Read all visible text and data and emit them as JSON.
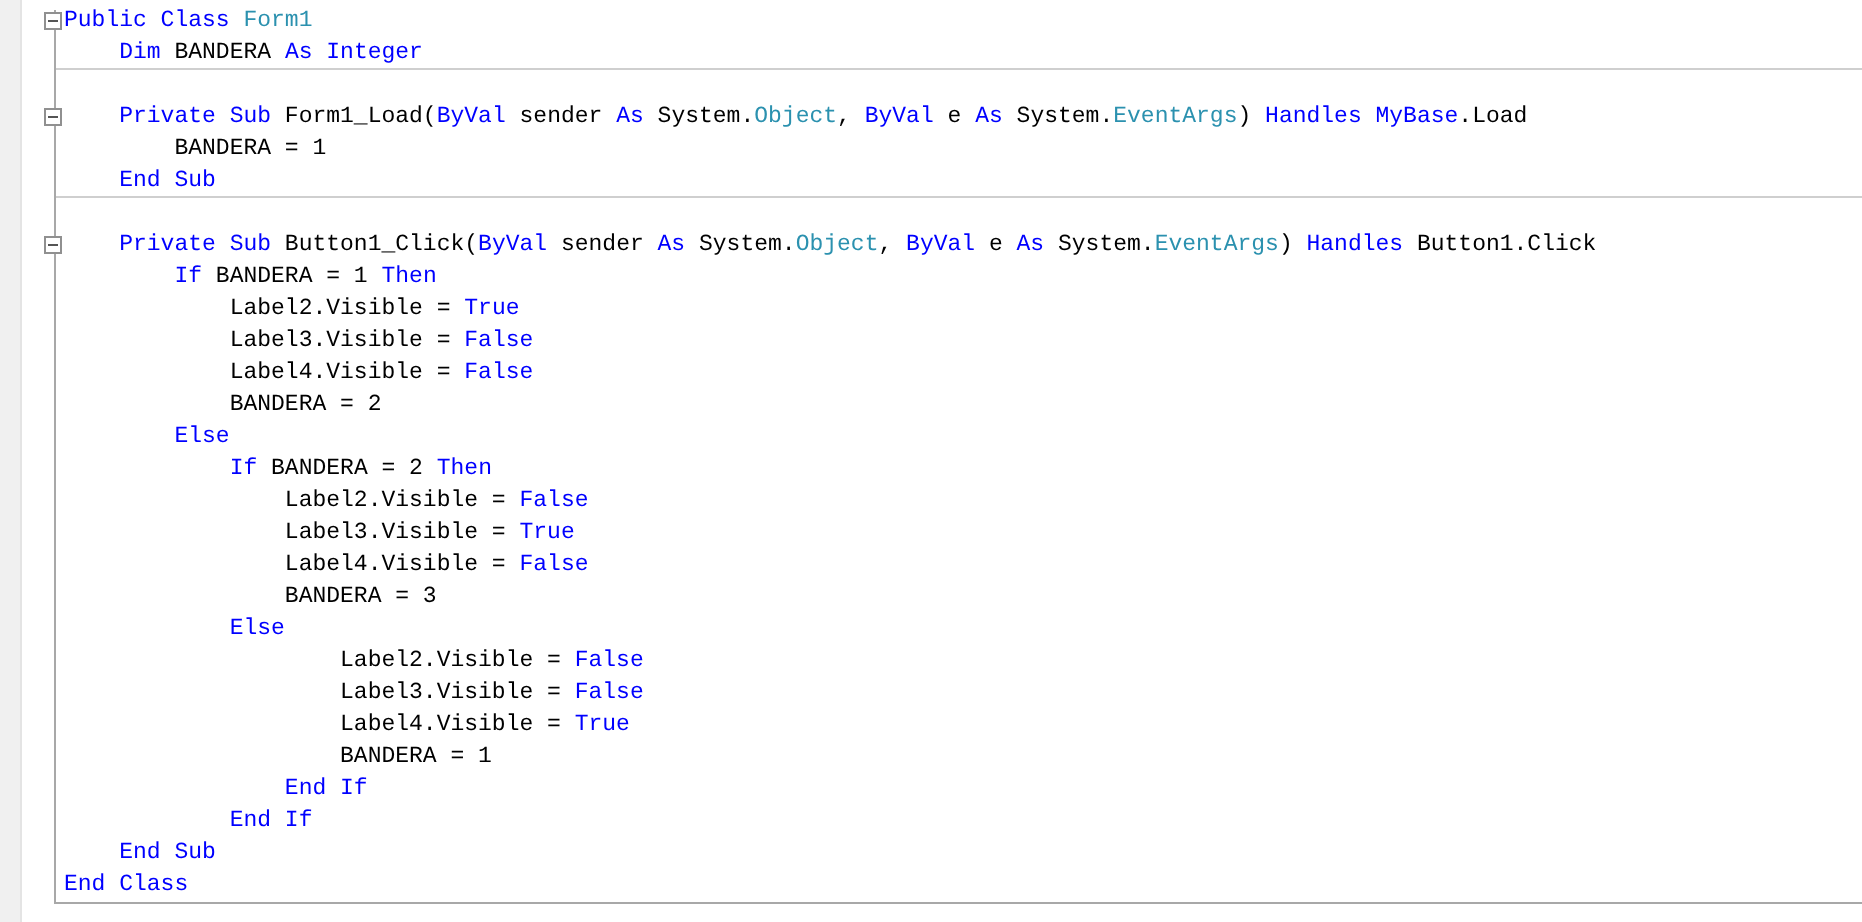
{
  "editor": {
    "lines": [
      {
        "toggle": {
          "expanded": true
        },
        "separator": false,
        "tokens": [
          {
            "kind": "keyword",
            "text": "Public Class "
          },
          {
            "kind": "type",
            "text": "Form1"
          }
        ]
      },
      {
        "separator": true,
        "tokens": [
          {
            "kind": "keyword",
            "text": "    Dim "
          },
          {
            "kind": "plain",
            "text": "BANDERA "
          },
          {
            "kind": "keyword",
            "text": "As Integer"
          }
        ]
      },
      {
        "separator": false
      },
      {
        "toggle": {
          "expanded": true
        },
        "separator": false,
        "tokens": [
          {
            "kind": "keyword",
            "text": "    Private Sub "
          },
          {
            "kind": "plain",
            "text": "Form1_Load("
          },
          {
            "kind": "keyword",
            "text": "ByVal "
          },
          {
            "kind": "plain",
            "text": "sender "
          },
          {
            "kind": "keyword",
            "text": "As "
          },
          {
            "kind": "plain",
            "text": "System."
          },
          {
            "kind": "type",
            "text": "Object"
          },
          {
            "kind": "plain",
            "text": ", "
          },
          {
            "kind": "keyword",
            "text": "ByVal "
          },
          {
            "kind": "plain",
            "text": "e "
          },
          {
            "kind": "keyword",
            "text": "As "
          },
          {
            "kind": "plain",
            "text": "System."
          },
          {
            "kind": "type",
            "text": "EventArgs"
          },
          {
            "kind": "plain",
            "text": ") "
          },
          {
            "kind": "keyword",
            "text": "Handles MyBase"
          },
          {
            "kind": "plain",
            "text": ".Load"
          }
        ]
      },
      {
        "separator": false,
        "tokens": [
          {
            "kind": "plain",
            "text": "        BANDERA = 1"
          }
        ]
      },
      {
        "separator": true,
        "tokens": [
          {
            "kind": "keyword",
            "text": "    End Sub"
          }
        ]
      },
      {
        "separator": false
      },
      {
        "toggle": {
          "expanded": true
        },
        "separator": false,
        "tokens": [
          {
            "kind": "keyword",
            "text": "    Private Sub "
          },
          {
            "kind": "plain",
            "text": "Button1_Click("
          },
          {
            "kind": "keyword",
            "text": "ByVal "
          },
          {
            "kind": "plain",
            "text": "sender "
          },
          {
            "kind": "keyword",
            "text": "As "
          },
          {
            "kind": "plain",
            "text": "System."
          },
          {
            "kind": "type",
            "text": "Object"
          },
          {
            "kind": "plain",
            "text": ", "
          },
          {
            "kind": "keyword",
            "text": "ByVal "
          },
          {
            "kind": "plain",
            "text": "e "
          },
          {
            "kind": "keyword",
            "text": "As "
          },
          {
            "kind": "plain",
            "text": "System."
          },
          {
            "kind": "type",
            "text": "EventArgs"
          },
          {
            "kind": "plain",
            "text": ") "
          },
          {
            "kind": "keyword",
            "text": "Handles "
          },
          {
            "kind": "plain",
            "text": "Button1.Click"
          }
        ]
      },
      {
        "separator": false,
        "tokens": [
          {
            "kind": "keyword",
            "text": "        If "
          },
          {
            "kind": "plain",
            "text": "BANDERA = 1 "
          },
          {
            "kind": "keyword",
            "text": "Then"
          }
        ]
      },
      {
        "separator": false,
        "tokens": [
          {
            "kind": "plain",
            "text": "            Label2.Visible = "
          },
          {
            "kind": "keyword",
            "text": "True"
          }
        ]
      },
      {
        "separator": false,
        "tokens": [
          {
            "kind": "plain",
            "text": "            Label3.Visible = "
          },
          {
            "kind": "keyword",
            "text": "False"
          }
        ]
      },
      {
        "separator": false,
        "tokens": [
          {
            "kind": "plain",
            "text": "            Label4.Visible = "
          },
          {
            "kind": "keyword",
            "text": "False"
          }
        ]
      },
      {
        "separator": false,
        "tokens": [
          {
            "kind": "plain",
            "text": "            BANDERA = 2"
          }
        ]
      },
      {
        "separator": false,
        "tokens": [
          {
            "kind": "keyword",
            "text": "        Else"
          }
        ]
      },
      {
        "separator": false,
        "tokens": [
          {
            "kind": "keyword",
            "text": "            If "
          },
          {
            "kind": "plain",
            "text": "BANDERA = 2 "
          },
          {
            "kind": "keyword",
            "text": "Then"
          }
        ]
      },
      {
        "separator": false,
        "tokens": [
          {
            "kind": "plain",
            "text": "                Label2.Visible = "
          },
          {
            "kind": "keyword",
            "text": "False"
          }
        ]
      },
      {
        "separator": false,
        "tokens": [
          {
            "kind": "plain",
            "text": "                Label3.Visible = "
          },
          {
            "kind": "keyword",
            "text": "True"
          }
        ]
      },
      {
        "separator": false,
        "tokens": [
          {
            "kind": "plain",
            "text": "                Label4.Visible = "
          },
          {
            "kind": "keyword",
            "text": "False"
          }
        ]
      },
      {
        "separator": false,
        "tokens": [
          {
            "kind": "plain",
            "text": "                BANDERA = 3"
          }
        ]
      },
      {
        "separator": false,
        "tokens": [
          {
            "kind": "keyword",
            "text": "            Else"
          }
        ]
      },
      {
        "separator": false,
        "tokens": [
          {
            "kind": "plain",
            "text": "                    Label2.Visible = "
          },
          {
            "kind": "keyword",
            "text": "False"
          }
        ]
      },
      {
        "separator": false,
        "tokens": [
          {
            "kind": "plain",
            "text": "                    Label3.Visible = "
          },
          {
            "kind": "keyword",
            "text": "False"
          }
        ]
      },
      {
        "separator": false,
        "tokens": [
          {
            "kind": "plain",
            "text": "                    Label4.Visible = "
          },
          {
            "kind": "keyword",
            "text": "True"
          }
        ]
      },
      {
        "separator": false,
        "tokens": [
          {
            "kind": "plain",
            "text": "                    BANDERA = 1"
          }
        ]
      },
      {
        "separator": false,
        "tokens": [
          {
            "kind": "keyword",
            "text": "                End If"
          }
        ]
      },
      {
        "separator": false,
        "tokens": [
          {
            "kind": "keyword",
            "text": "            End If"
          }
        ]
      },
      {
        "separator": false,
        "tokens": [
          {
            "kind": "keyword",
            "text": "    End Sub"
          }
        ]
      },
      {
        "separator": false,
        "tokens": [
          {
            "kind": "keyword",
            "text": "End Class"
          }
        ]
      }
    ]
  }
}
